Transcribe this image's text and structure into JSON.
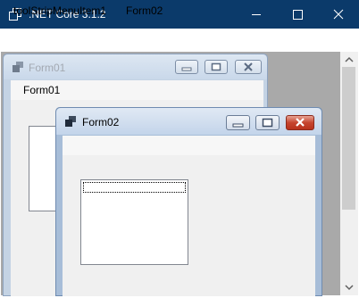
{
  "window": {
    "title": ".NET Core 3.1.2",
    "icon": "window-icon",
    "controls": [
      "minimize-icon",
      "maximize-icon",
      "close-icon"
    ],
    "titlebar_color": "#0b3a6a"
  },
  "menubar": {
    "items": [
      {
        "label": "toolStripMenuItem1"
      },
      {
        "label": "Form02"
      }
    ]
  },
  "mdi": {
    "background": "#a9a9a9",
    "children": [
      {
        "title": "Form01",
        "state": "inactive",
        "menu": {
          "items": [
            {
              "label": "Form01"
            }
          ]
        }
      },
      {
        "title": "Form02",
        "state": "active"
      }
    ]
  }
}
